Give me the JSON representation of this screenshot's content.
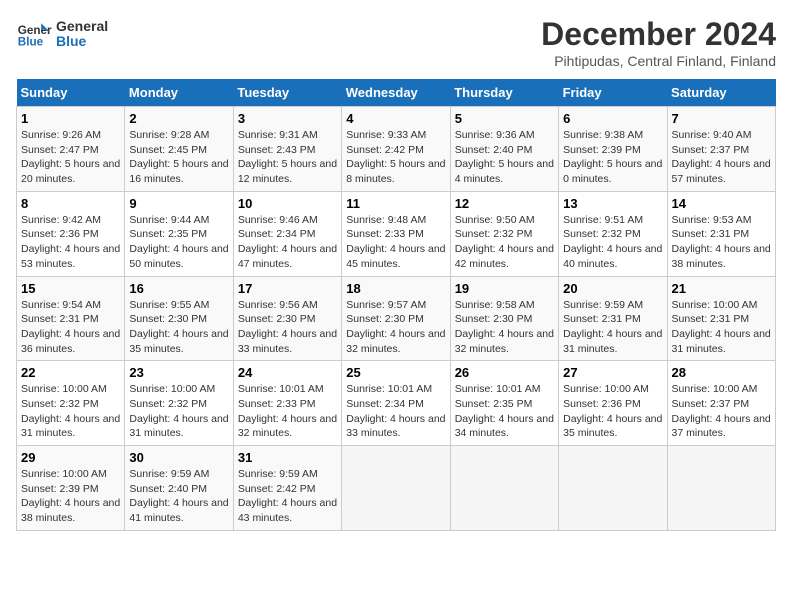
{
  "header": {
    "logo_line1": "General",
    "logo_line2": "Blue",
    "title": "December 2024",
    "subtitle": "Pihtipudas, Central Finland, Finland"
  },
  "calendar": {
    "days_of_week": [
      "Sunday",
      "Monday",
      "Tuesday",
      "Wednesday",
      "Thursday",
      "Friday",
      "Saturday"
    ],
    "weeks": [
      [
        {
          "day": "1",
          "sunrise": "Sunrise: 9:26 AM",
          "sunset": "Sunset: 2:47 PM",
          "daylight": "Daylight: 5 hours and 20 minutes."
        },
        {
          "day": "2",
          "sunrise": "Sunrise: 9:28 AM",
          "sunset": "Sunset: 2:45 PM",
          "daylight": "Daylight: 5 hours and 16 minutes."
        },
        {
          "day": "3",
          "sunrise": "Sunrise: 9:31 AM",
          "sunset": "Sunset: 2:43 PM",
          "daylight": "Daylight: 5 hours and 12 minutes."
        },
        {
          "day": "4",
          "sunrise": "Sunrise: 9:33 AM",
          "sunset": "Sunset: 2:42 PM",
          "daylight": "Daylight: 5 hours and 8 minutes."
        },
        {
          "day": "5",
          "sunrise": "Sunrise: 9:36 AM",
          "sunset": "Sunset: 2:40 PM",
          "daylight": "Daylight: 5 hours and 4 minutes."
        },
        {
          "day": "6",
          "sunrise": "Sunrise: 9:38 AM",
          "sunset": "Sunset: 2:39 PM",
          "daylight": "Daylight: 5 hours and 0 minutes."
        },
        {
          "day": "7",
          "sunrise": "Sunrise: 9:40 AM",
          "sunset": "Sunset: 2:37 PM",
          "daylight": "Daylight: 4 hours and 57 minutes."
        }
      ],
      [
        {
          "day": "8",
          "sunrise": "Sunrise: 9:42 AM",
          "sunset": "Sunset: 2:36 PM",
          "daylight": "Daylight: 4 hours and 53 minutes."
        },
        {
          "day": "9",
          "sunrise": "Sunrise: 9:44 AM",
          "sunset": "Sunset: 2:35 PM",
          "daylight": "Daylight: 4 hours and 50 minutes."
        },
        {
          "day": "10",
          "sunrise": "Sunrise: 9:46 AM",
          "sunset": "Sunset: 2:34 PM",
          "daylight": "Daylight: 4 hours and 47 minutes."
        },
        {
          "day": "11",
          "sunrise": "Sunrise: 9:48 AM",
          "sunset": "Sunset: 2:33 PM",
          "daylight": "Daylight: 4 hours and 45 minutes."
        },
        {
          "day": "12",
          "sunrise": "Sunrise: 9:50 AM",
          "sunset": "Sunset: 2:32 PM",
          "daylight": "Daylight: 4 hours and 42 minutes."
        },
        {
          "day": "13",
          "sunrise": "Sunrise: 9:51 AM",
          "sunset": "Sunset: 2:32 PM",
          "daylight": "Daylight: 4 hours and 40 minutes."
        },
        {
          "day": "14",
          "sunrise": "Sunrise: 9:53 AM",
          "sunset": "Sunset: 2:31 PM",
          "daylight": "Daylight: 4 hours and 38 minutes."
        }
      ],
      [
        {
          "day": "15",
          "sunrise": "Sunrise: 9:54 AM",
          "sunset": "Sunset: 2:31 PM",
          "daylight": "Daylight: 4 hours and 36 minutes."
        },
        {
          "day": "16",
          "sunrise": "Sunrise: 9:55 AM",
          "sunset": "Sunset: 2:30 PM",
          "daylight": "Daylight: 4 hours and 35 minutes."
        },
        {
          "day": "17",
          "sunrise": "Sunrise: 9:56 AM",
          "sunset": "Sunset: 2:30 PM",
          "daylight": "Daylight: 4 hours and 33 minutes."
        },
        {
          "day": "18",
          "sunrise": "Sunrise: 9:57 AM",
          "sunset": "Sunset: 2:30 PM",
          "daylight": "Daylight: 4 hours and 32 minutes."
        },
        {
          "day": "19",
          "sunrise": "Sunrise: 9:58 AM",
          "sunset": "Sunset: 2:30 PM",
          "daylight": "Daylight: 4 hours and 32 minutes."
        },
        {
          "day": "20",
          "sunrise": "Sunrise: 9:59 AM",
          "sunset": "Sunset: 2:31 PM",
          "daylight": "Daylight: 4 hours and 31 minutes."
        },
        {
          "day": "21",
          "sunrise": "Sunrise: 10:00 AM",
          "sunset": "Sunset: 2:31 PM",
          "daylight": "Daylight: 4 hours and 31 minutes."
        }
      ],
      [
        {
          "day": "22",
          "sunrise": "Sunrise: 10:00 AM",
          "sunset": "Sunset: 2:32 PM",
          "daylight": "Daylight: 4 hours and 31 minutes."
        },
        {
          "day": "23",
          "sunrise": "Sunrise: 10:00 AM",
          "sunset": "Sunset: 2:32 PM",
          "daylight": "Daylight: 4 hours and 31 minutes."
        },
        {
          "day": "24",
          "sunrise": "Sunrise: 10:01 AM",
          "sunset": "Sunset: 2:33 PM",
          "daylight": "Daylight: 4 hours and 32 minutes."
        },
        {
          "day": "25",
          "sunrise": "Sunrise: 10:01 AM",
          "sunset": "Sunset: 2:34 PM",
          "daylight": "Daylight: 4 hours and 33 minutes."
        },
        {
          "day": "26",
          "sunrise": "Sunrise: 10:01 AM",
          "sunset": "Sunset: 2:35 PM",
          "daylight": "Daylight: 4 hours and 34 minutes."
        },
        {
          "day": "27",
          "sunrise": "Sunrise: 10:00 AM",
          "sunset": "Sunset: 2:36 PM",
          "daylight": "Daylight: 4 hours and 35 minutes."
        },
        {
          "day": "28",
          "sunrise": "Sunrise: 10:00 AM",
          "sunset": "Sunset: 2:37 PM",
          "daylight": "Daylight: 4 hours and 37 minutes."
        }
      ],
      [
        {
          "day": "29",
          "sunrise": "Sunrise: 10:00 AM",
          "sunset": "Sunset: 2:39 PM",
          "daylight": "Daylight: 4 hours and 38 minutes."
        },
        {
          "day": "30",
          "sunrise": "Sunrise: 9:59 AM",
          "sunset": "Sunset: 2:40 PM",
          "daylight": "Daylight: 4 hours and 41 minutes."
        },
        {
          "day": "31",
          "sunrise": "Sunrise: 9:59 AM",
          "sunset": "Sunset: 2:42 PM",
          "daylight": "Daylight: 4 hours and 43 minutes."
        },
        null,
        null,
        null,
        null
      ]
    ]
  }
}
